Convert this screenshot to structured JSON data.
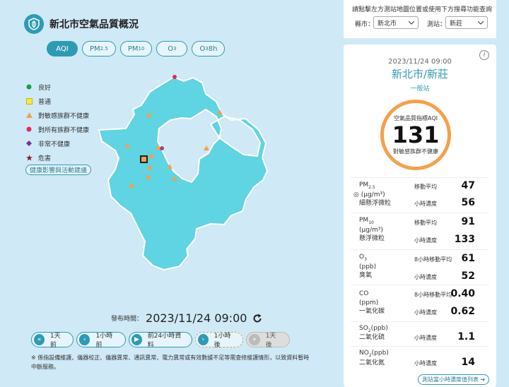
{
  "header": {
    "title": "新北市空氣品質概況"
  },
  "tabs": [
    {
      "label": "AQI",
      "sub": "",
      "active": true
    },
    {
      "label": "PM",
      "sub": "2.5",
      "active": false
    },
    {
      "label": "PM",
      "sub": "10",
      "active": false
    },
    {
      "label": "O",
      "sub": "3",
      "active": false
    },
    {
      "label": "O",
      "sub": "3",
      "suffix": " 8h",
      "active": false
    }
  ],
  "legend": [
    {
      "label": "良好",
      "color": "#1a9e4b",
      "shape": "circle"
    },
    {
      "label": "普通",
      "color": "#f5e94b",
      "shape": "square"
    },
    {
      "label": "對敏感族群不健康",
      "color": "#f5a04b",
      "shape": "triangle"
    },
    {
      "label": "對所有族群不健康",
      "color": "#e8295a",
      "shape": "circle"
    },
    {
      "label": "非常不健康",
      "color": "#7a2ea0",
      "shape": "diamond"
    },
    {
      "label": "危害",
      "color": "#8b1a2a",
      "shape": "star"
    }
  ],
  "health_button": "健康影響與活動建議",
  "publish": {
    "label": "發布時間：",
    "time": "2023/11/24 09:00"
  },
  "timebar": [
    {
      "label": "1天前",
      "icon": "«"
    },
    {
      "label": "1小時前",
      "icon": "‹"
    },
    {
      "label": "前24小時資料",
      "icon": "▶"
    },
    {
      "label": "1小時後",
      "icon": "›"
    },
    {
      "label": "1天後",
      "icon": "»"
    }
  ],
  "note": "※ 係指設備維護、儀器校正、儀器異常、通訊異常、電力異常或有效數據不足等需查修維護情形，以致資料暫時中斷服務。",
  "query": {
    "hint": "請點擊左方測站地圖位置或使用下方搜尋功能查詢",
    "city_label": "縣市：",
    "city_value": "新北市",
    "station_label": "測站：",
    "station_value": "新莊"
  },
  "panel": {
    "datetime": "2023/11/24 09:00",
    "station": "新北市/新莊",
    "station_type": "一般站",
    "aqi_label": "空氣品質指標AQI",
    "aqi_value": "131",
    "aqi_status": "對敏感族群不健康",
    "aqi_color": "#f5a04b",
    "list_button": "測站當小時濃度值列表 ➔"
  },
  "pollutants": [
    {
      "name": "PM",
      "sub": "2.5",
      "unit": "(μg/m³)",
      "cname": "細懸浮微粒",
      "m1": "移動平均",
      "v1": "47",
      "m2": "小時濃度",
      "v2": "56",
      "marked": true
    },
    {
      "name": "PM",
      "sub": "10",
      "unit": "(μg/m³)",
      "cname": "懸浮微粒",
      "m1": "移動平均",
      "v1": "91",
      "m2": "小時濃度",
      "v2": "133",
      "marked": false
    },
    {
      "name": "O",
      "sub": "3",
      "unit": "(ppb)",
      "cname": "臭氧",
      "m1": "8小時移動平均",
      "v1": "61",
      "m2": "小時濃度",
      "v2": "52",
      "marked": false
    },
    {
      "name": "CO",
      "sub": "",
      "unit": "(ppm)",
      "cname": "一氧化碳",
      "m1": "8小時移動平均",
      "v1": "0.40",
      "m2": "小時濃度",
      "v2": "0.62",
      "marked": false
    },
    {
      "name": "SO",
      "sub": "2",
      "unit": "(ppb)",
      "cname": "二氧化硫",
      "m1": "",
      "v1": "",
      "m2": "小時濃度",
      "v2": "1.1",
      "marked": false
    },
    {
      "name": "NO",
      "sub": "2",
      "unit": "(ppb)",
      "cname": "二氧化氮",
      "m1": "",
      "v1": "",
      "m2": "小時濃度",
      "v2": "14",
      "marked": false
    }
  ]
}
